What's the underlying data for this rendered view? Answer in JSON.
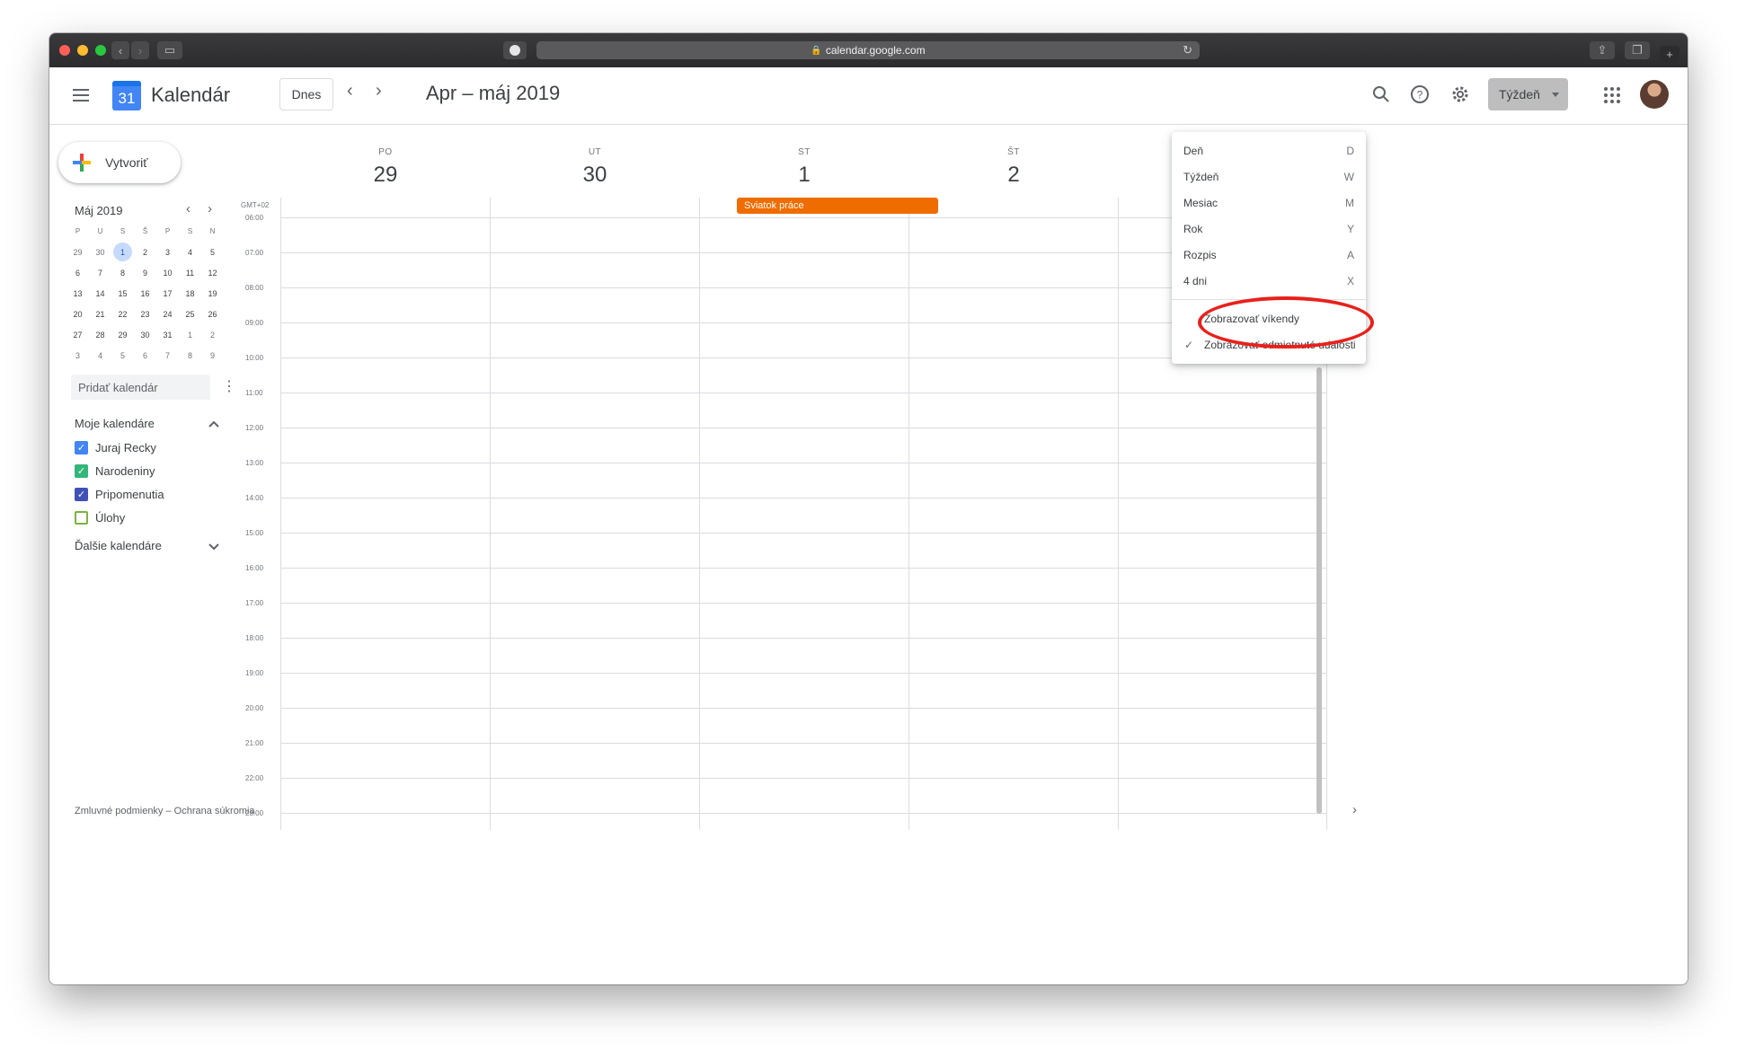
{
  "browser": {
    "url": "calendar.google.com"
  },
  "header": {
    "app_name": "Kalendár",
    "logo_number": "31",
    "today_label": "Dnes",
    "range_title": "Apr – máj 2019",
    "view_label": "Týždeň"
  },
  "sidebar": {
    "create_label": "Vytvoriť",
    "mini_title": "Máj 2019",
    "weekday_heads": [
      "P",
      "U",
      "S",
      "Š",
      "P",
      "S",
      "N"
    ],
    "weeks": [
      [
        "29",
        "30",
        "1",
        "2",
        "3",
        "4",
        "5"
      ],
      [
        "6",
        "7",
        "8",
        "9",
        "10",
        "11",
        "12"
      ],
      [
        "13",
        "14",
        "15",
        "16",
        "17",
        "18",
        "19"
      ],
      [
        "20",
        "21",
        "22",
        "23",
        "24",
        "25",
        "26"
      ],
      [
        "27",
        "28",
        "29",
        "30",
        "31",
        "1",
        "2"
      ],
      [
        "3",
        "4",
        "5",
        "6",
        "7",
        "8",
        "9"
      ]
    ],
    "add_calendar_placeholder": "Pridať kalendár",
    "my_calendars_title": "Moje kalendáre",
    "my_calendars": [
      {
        "label": "Juraj Recky",
        "color": "#4285f4",
        "checked": true
      },
      {
        "label": "Narodeniny",
        "color": "#33b679",
        "checked": true
      },
      {
        "label": "Pripomenutia",
        "color": "#3f51b5",
        "checked": true
      },
      {
        "label": "Úlohy",
        "color": "#7cb342",
        "checked": false
      }
    ],
    "other_calendars_title": "Ďalšie kalendáre",
    "footer": "Zmluvné podmienky – Ochrana súkromia"
  },
  "week": {
    "days": [
      {
        "dow": "PO",
        "num": "29"
      },
      {
        "dow": "UT",
        "num": "30"
      },
      {
        "dow": "ST",
        "num": "1"
      },
      {
        "dow": "ŠT",
        "num": "2"
      }
    ],
    "timezone": "GMT+02",
    "allday_event": {
      "label": "Sviatok práce",
      "color": "#ef6c00"
    },
    "times": [
      "06:00",
      "07:00",
      "08:00",
      "09:00",
      "10:00",
      "11:00",
      "12:00",
      "13:00",
      "14:00",
      "15:00",
      "16:00",
      "17:00",
      "18:00",
      "19:00",
      "20:00",
      "21:00",
      "22:00",
      "23:00"
    ]
  },
  "view_menu": {
    "items": [
      {
        "label": "Deň",
        "key": "D"
      },
      {
        "label": "Týždeň",
        "key": "W"
      },
      {
        "label": "Mesiac",
        "key": "M"
      },
      {
        "label": "Rok",
        "key": "Y"
      },
      {
        "label": "Rozpis",
        "key": "A"
      },
      {
        "label": "4 dni",
        "key": "X"
      }
    ],
    "options": [
      {
        "label": "Zobrazovať víkendy",
        "checked": false
      },
      {
        "label": "Zobrazovať odmietnuté udalosti",
        "checked": true
      }
    ],
    "annotation_color": "#e8211c"
  }
}
